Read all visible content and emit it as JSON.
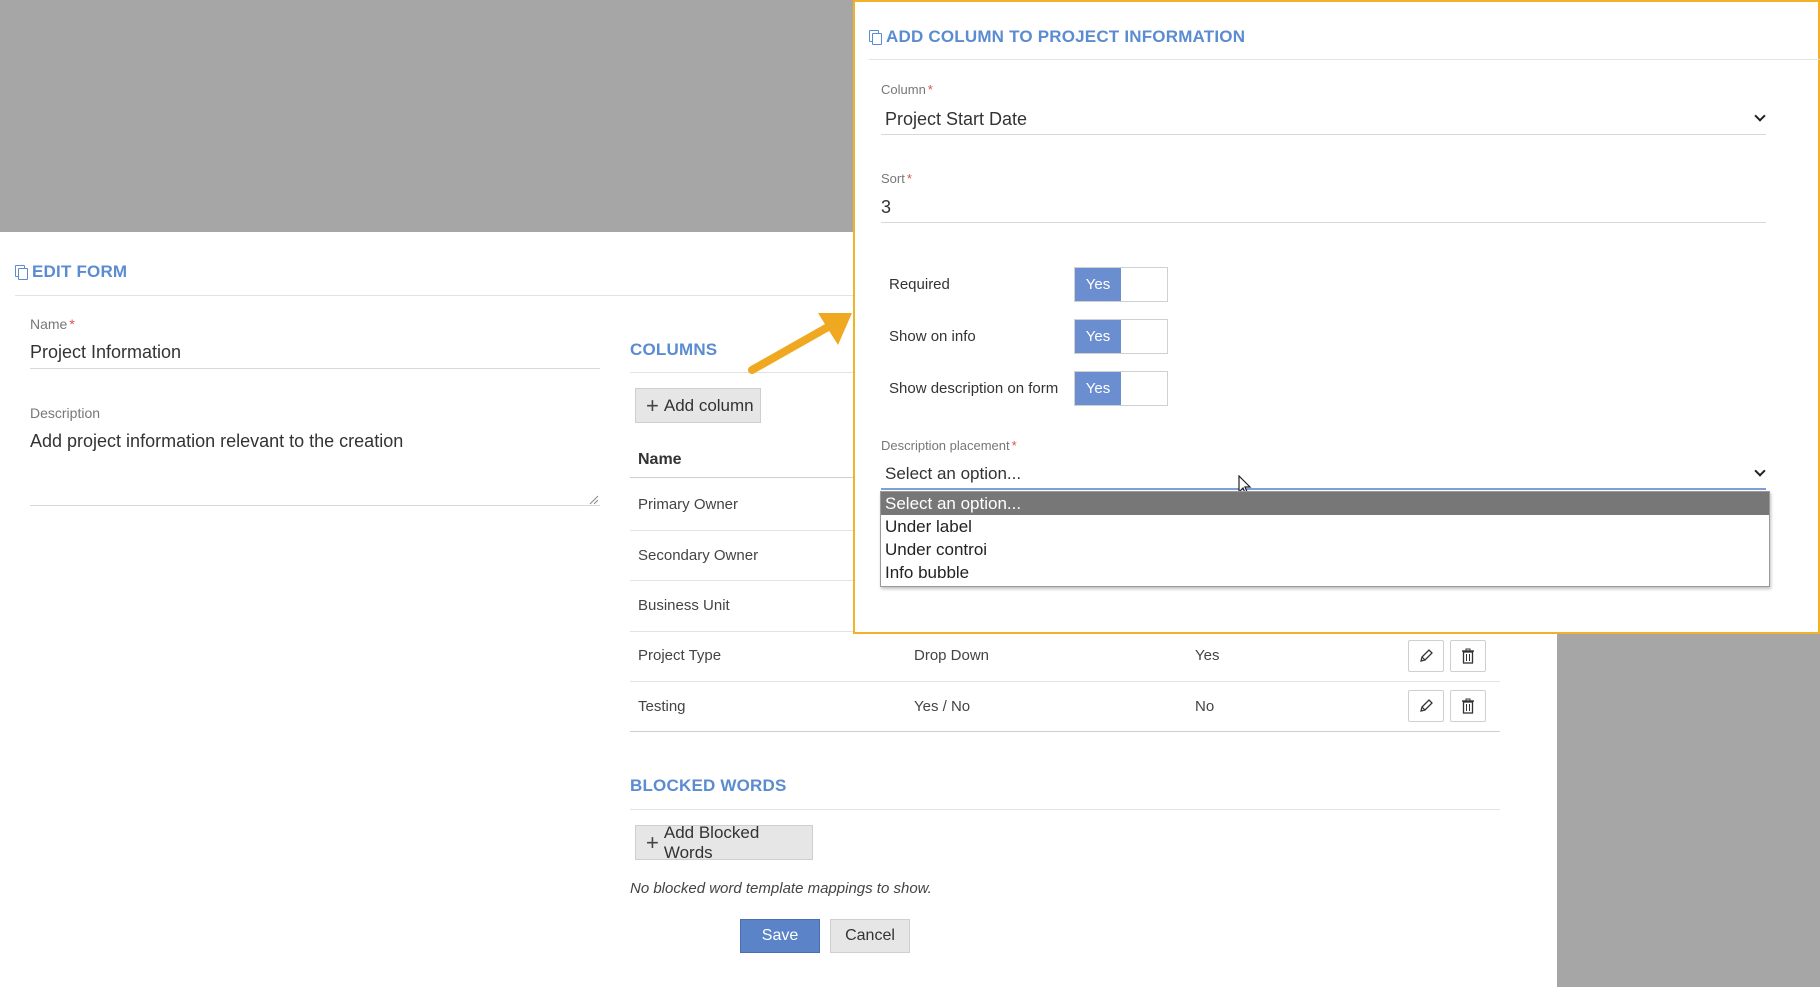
{
  "edit_form": {
    "title": "EDIT FORM",
    "name_label": "Name",
    "name_value": "Project Information",
    "description_label": "Description",
    "description_value": "Add project information relevant to the creation"
  },
  "columns": {
    "title": "COLUMNS",
    "add_button": "Add column",
    "header_name": "Name",
    "rows": [
      {
        "name": "Primary Owner",
        "type": "",
        "required": ""
      },
      {
        "name": "Secondary Owner",
        "type": "",
        "required": ""
      },
      {
        "name": "Business Unit",
        "type": "",
        "required": ""
      },
      {
        "name": "Project Type",
        "type": "Drop Down",
        "required": "Yes"
      },
      {
        "name": "Testing",
        "type": "Yes / No",
        "required": "No"
      }
    ]
  },
  "blocked_words": {
    "title": "BLOCKED WORDS",
    "add_button": "Add Blocked Words",
    "empty_text": "No blocked word template mappings to show."
  },
  "actions": {
    "save": "Save",
    "cancel": "Cancel"
  },
  "modal": {
    "title": "ADD COLUMN TO PROJECT INFORMATION",
    "column_label": "Column",
    "column_value": "Project Start Date",
    "sort_label": "Sort",
    "sort_value": "3",
    "toggles": [
      {
        "label": "Required",
        "value": "Yes"
      },
      {
        "label": "Show on info",
        "value": "Yes"
      },
      {
        "label": "Show description on form",
        "value": "Yes"
      }
    ],
    "placement_label": "Description placement",
    "placement_value": "Select an option...",
    "placement_options": [
      "Select an option...",
      "Under label",
      "Under controi",
      "Info bubble"
    ]
  },
  "colors": {
    "accent": "#5b8bd0",
    "modal_border": "#f1b22a",
    "arrow": "#f0a820",
    "toggle_on": "#6b8ed0",
    "backdrop": "#a6a6a6"
  },
  "icons": [
    "copy-icon",
    "plus-icon",
    "pencil-icon",
    "trash-icon",
    "chevron-down-icon",
    "mouse-cursor-icon",
    "annotation-arrow"
  ]
}
